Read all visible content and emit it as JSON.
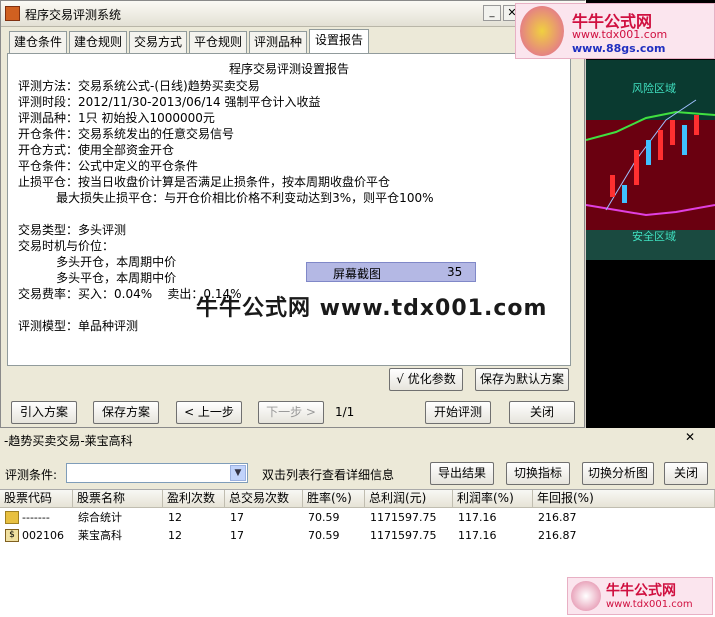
{
  "dialog": {
    "title": "程序交易评测系统",
    "tabs": [
      "建仓条件",
      "建仓规则",
      "交易方式",
      "平仓规则",
      "评测品种",
      "设置报告"
    ],
    "active_tab": 5,
    "report": {
      "title": "程序交易评测设置报告",
      "lines": [
        "评测方法：交易系统公式-(日线)趋势买卖交易",
        "评测时段：2012/11/30-2013/06/14 强制平仓计入收益",
        "评测品种：1只 初始投入1000000元",
        "开仓条件：交易系统发出的任意交易信号",
        "开仓方式：使用全部资金开仓",
        "平仓条件：公式中定义的平仓条件",
        "止损平仓：按当日收盘价计算是否满足止损条件，按本周期收盘价平仓",
        "          最大损失止损平仓：与开仓价相比价格不利变动达到3%，则平仓100%",
        "",
        "交易类型：多头评测",
        "交易时机与价位：",
        "          多头开仓，本周期中价",
        "          多头平仓，本周期中价",
        "交易费率：买入：0.04%    卖出：0.14%",
        "",
        "评测模型：单品种评测"
      ]
    },
    "badge": {
      "label": "屏幕截图",
      "count": "35"
    },
    "watermark": "牛牛公式网 www.tdx001.com",
    "optimize_label": "优化参数",
    "save_default_label": "保存为默认方案",
    "footer": {
      "import_label": "引入方案",
      "save_label": "保存方案",
      "prev_label": "< 上一步",
      "next_label": "下一步 >",
      "page": "1/1",
      "start_label": "开始评测",
      "close_label": "关闭"
    }
  },
  "logo": {
    "name": "牛牛公式网",
    "url_top": "www.88gs.com",
    "url_bottom": "www.tdx001.com"
  },
  "chart": {
    "risk_label": "风险区域",
    "safe_label": "安全区域"
  },
  "results": {
    "title": "-趋势买卖交易-莱宝高科",
    "close_icon": "✕",
    "filter_label": "评测条件:",
    "filter_value": "",
    "hint": "双击列表行查看详细信息",
    "buttons": [
      "导出结果",
      "切换指标",
      "切换分析图",
      "关闭"
    ],
    "columns": [
      "股票代码",
      "股票名称",
      "盈利次数",
      "总交易次数",
      "胜率(%)",
      "总利润(元)",
      "利润率(%)",
      "年回报(%)"
    ],
    "rows": [
      [
        "-------",
        "综合统计",
        "12",
        "17",
        "70.59",
        "1171597.75",
        "117.16",
        "216.87"
      ],
      [
        "002106",
        "莱宝高科",
        "12",
        "17",
        "70.59",
        "1171597.75",
        "117.16",
        "216.87"
      ]
    ]
  }
}
